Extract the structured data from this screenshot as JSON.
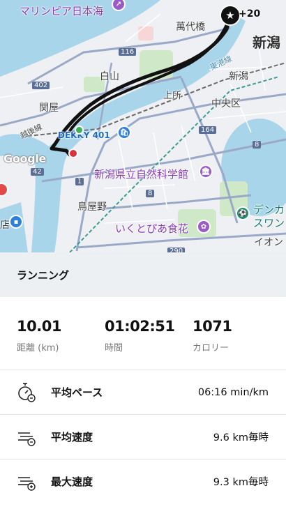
{
  "map": {
    "labels": {
      "marine_pia": "マリンピア日本海",
      "bandai_bridge": "萬代橋",
      "niigata": "新潟",
      "hakusan": "白山",
      "route_116": "116",
      "toko_line": "東港線",
      "niigata_small": "新潟",
      "kamitokoro": "上所",
      "sekiya": "関屋",
      "route_402": "402",
      "chuo_ku": "中央区",
      "etsugo_line": "越後線",
      "deky401": "DEKKY 401",
      "route_164": "164",
      "route_8_right": "8",
      "route_42": "42",
      "science_museum": "新潟県立自然科学館",
      "route_1": "1",
      "toriyano": "鳥屋野",
      "route_8": "8",
      "denka": "デンカ",
      "swan": "スワン",
      "ikutopia": "いくとぴあ食花",
      "aeon": "イオン",
      "route_290": "290",
      "side_kana": "",
      "left_edge": "店"
    },
    "google": "Google",
    "star_marker": "★",
    "bonus": "+20"
  },
  "activity": {
    "type": "ランニング"
  },
  "summary": {
    "distance": {
      "value": "10.01",
      "label": "距離 (km)"
    },
    "time": {
      "value": "01:02:51",
      "label": "時間"
    },
    "calories": {
      "value": "1071",
      "label": "カロリー"
    }
  },
  "details": [
    {
      "label": "平均ペース",
      "value": "06:16 min/km",
      "icon": "stopwatch-icon"
    },
    {
      "label": "平均速度",
      "value": "9.6 km毎時",
      "icon": "speed-lines-icon"
    },
    {
      "label": "最大速度",
      "value": "9.3 km毎時",
      "icon": "speed-lines-plus-icon"
    }
  ],
  "colors": {
    "water": "#a9d5ea",
    "route": "#111111",
    "park": "#cfe8c7",
    "header_bg": "#edf0f3",
    "start": "#3fae55",
    "end": "#d8323c"
  }
}
